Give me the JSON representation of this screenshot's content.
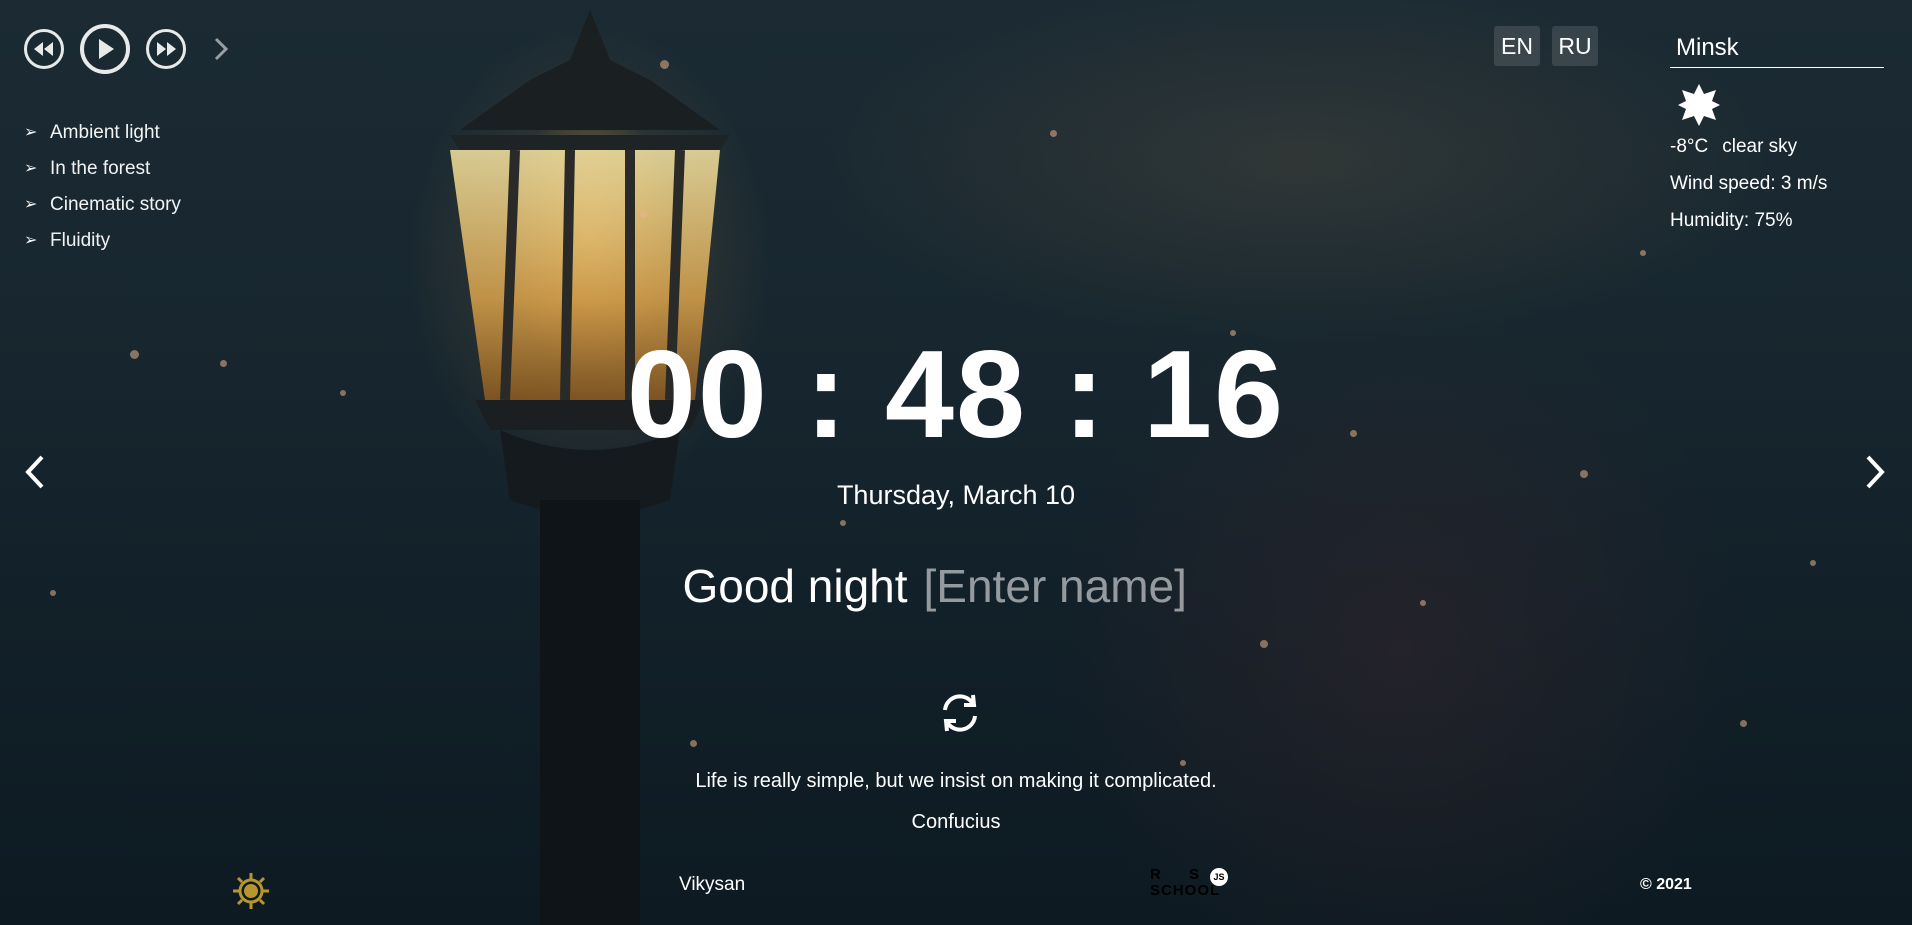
{
  "player": {
    "prev_icon": "rewind-icon",
    "play_icon": "play-icon",
    "next_icon": "fast-forward-icon",
    "expand_icon": "chevron-right-icon",
    "playlist": [
      {
        "label": "Ambient light"
      },
      {
        "label": "In the forest"
      },
      {
        "label": "Cinematic story"
      },
      {
        "label": "Fluidity"
      }
    ]
  },
  "language": {
    "en": "EN",
    "ru": "RU"
  },
  "weather": {
    "city": "Minsk",
    "icon": "clear-sky-sun-icon",
    "temperature": "-8°C",
    "description": "clear sky",
    "wind": "Wind speed: 3 m/s",
    "humidity": "Humidity: 75%"
  },
  "clock": {
    "time": "00 : 48 : 16",
    "date": "Thursday, March 10"
  },
  "greeting": {
    "text": "Good night",
    "name_placeholder": "[Enter name]"
  },
  "quote": {
    "text": "Life is really simple, but we insist on making it complicated.",
    "author": "Confucius"
  },
  "footer": {
    "github": "Vikysan",
    "logo_text": "RS SCHOOL JS",
    "year": "© 2021"
  },
  "colors": {
    "settings_gear": "#b8962e",
    "lamp_glow": "#f5c46a",
    "background": "#13212a"
  }
}
